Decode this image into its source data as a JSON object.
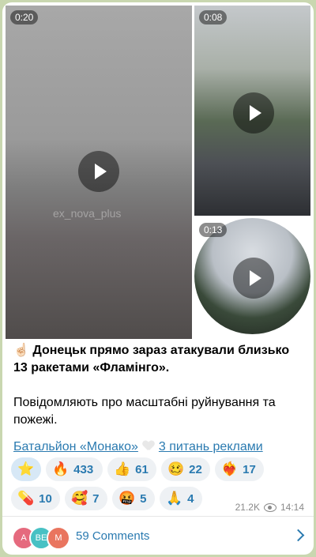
{
  "media": [
    {
      "duration": "0:20",
      "watermark": "ex_nova_plus"
    },
    {
      "duration": "0:08"
    },
    {
      "duration": "0:13"
    }
  ],
  "post": {
    "line1": "Донецьк прямо зараз атакували близько 13 ракетами «Фламінго».",
    "line2": "Повідомляють про масштабні руйнування та пожежі.",
    "link1": "Батальйон «Монако»",
    "link2": "3 питань реклами"
  },
  "reactions": [
    {
      "emoji": "⭐",
      "count": ""
    },
    {
      "emoji": "🔥",
      "count": "433"
    },
    {
      "emoji": "👍",
      "count": "61"
    },
    {
      "emoji": "🥴",
      "count": "22"
    },
    {
      "emoji": "❤️‍🔥",
      "count": "17"
    },
    {
      "emoji": "💊",
      "count": "10"
    },
    {
      "emoji": "🥰",
      "count": "7"
    },
    {
      "emoji": "🤬",
      "count": "5"
    },
    {
      "emoji": "🙏",
      "count": "4"
    }
  ],
  "views": "21.2K",
  "time": "14:14",
  "comments": {
    "avatars": [
      {
        "initials": "A",
        "color": "#e56a7e"
      },
      {
        "initials": "BE",
        "color": "#48c1c4"
      },
      {
        "initials": "M",
        "color": "#e9755f"
      }
    ],
    "label": "59 Comments"
  }
}
